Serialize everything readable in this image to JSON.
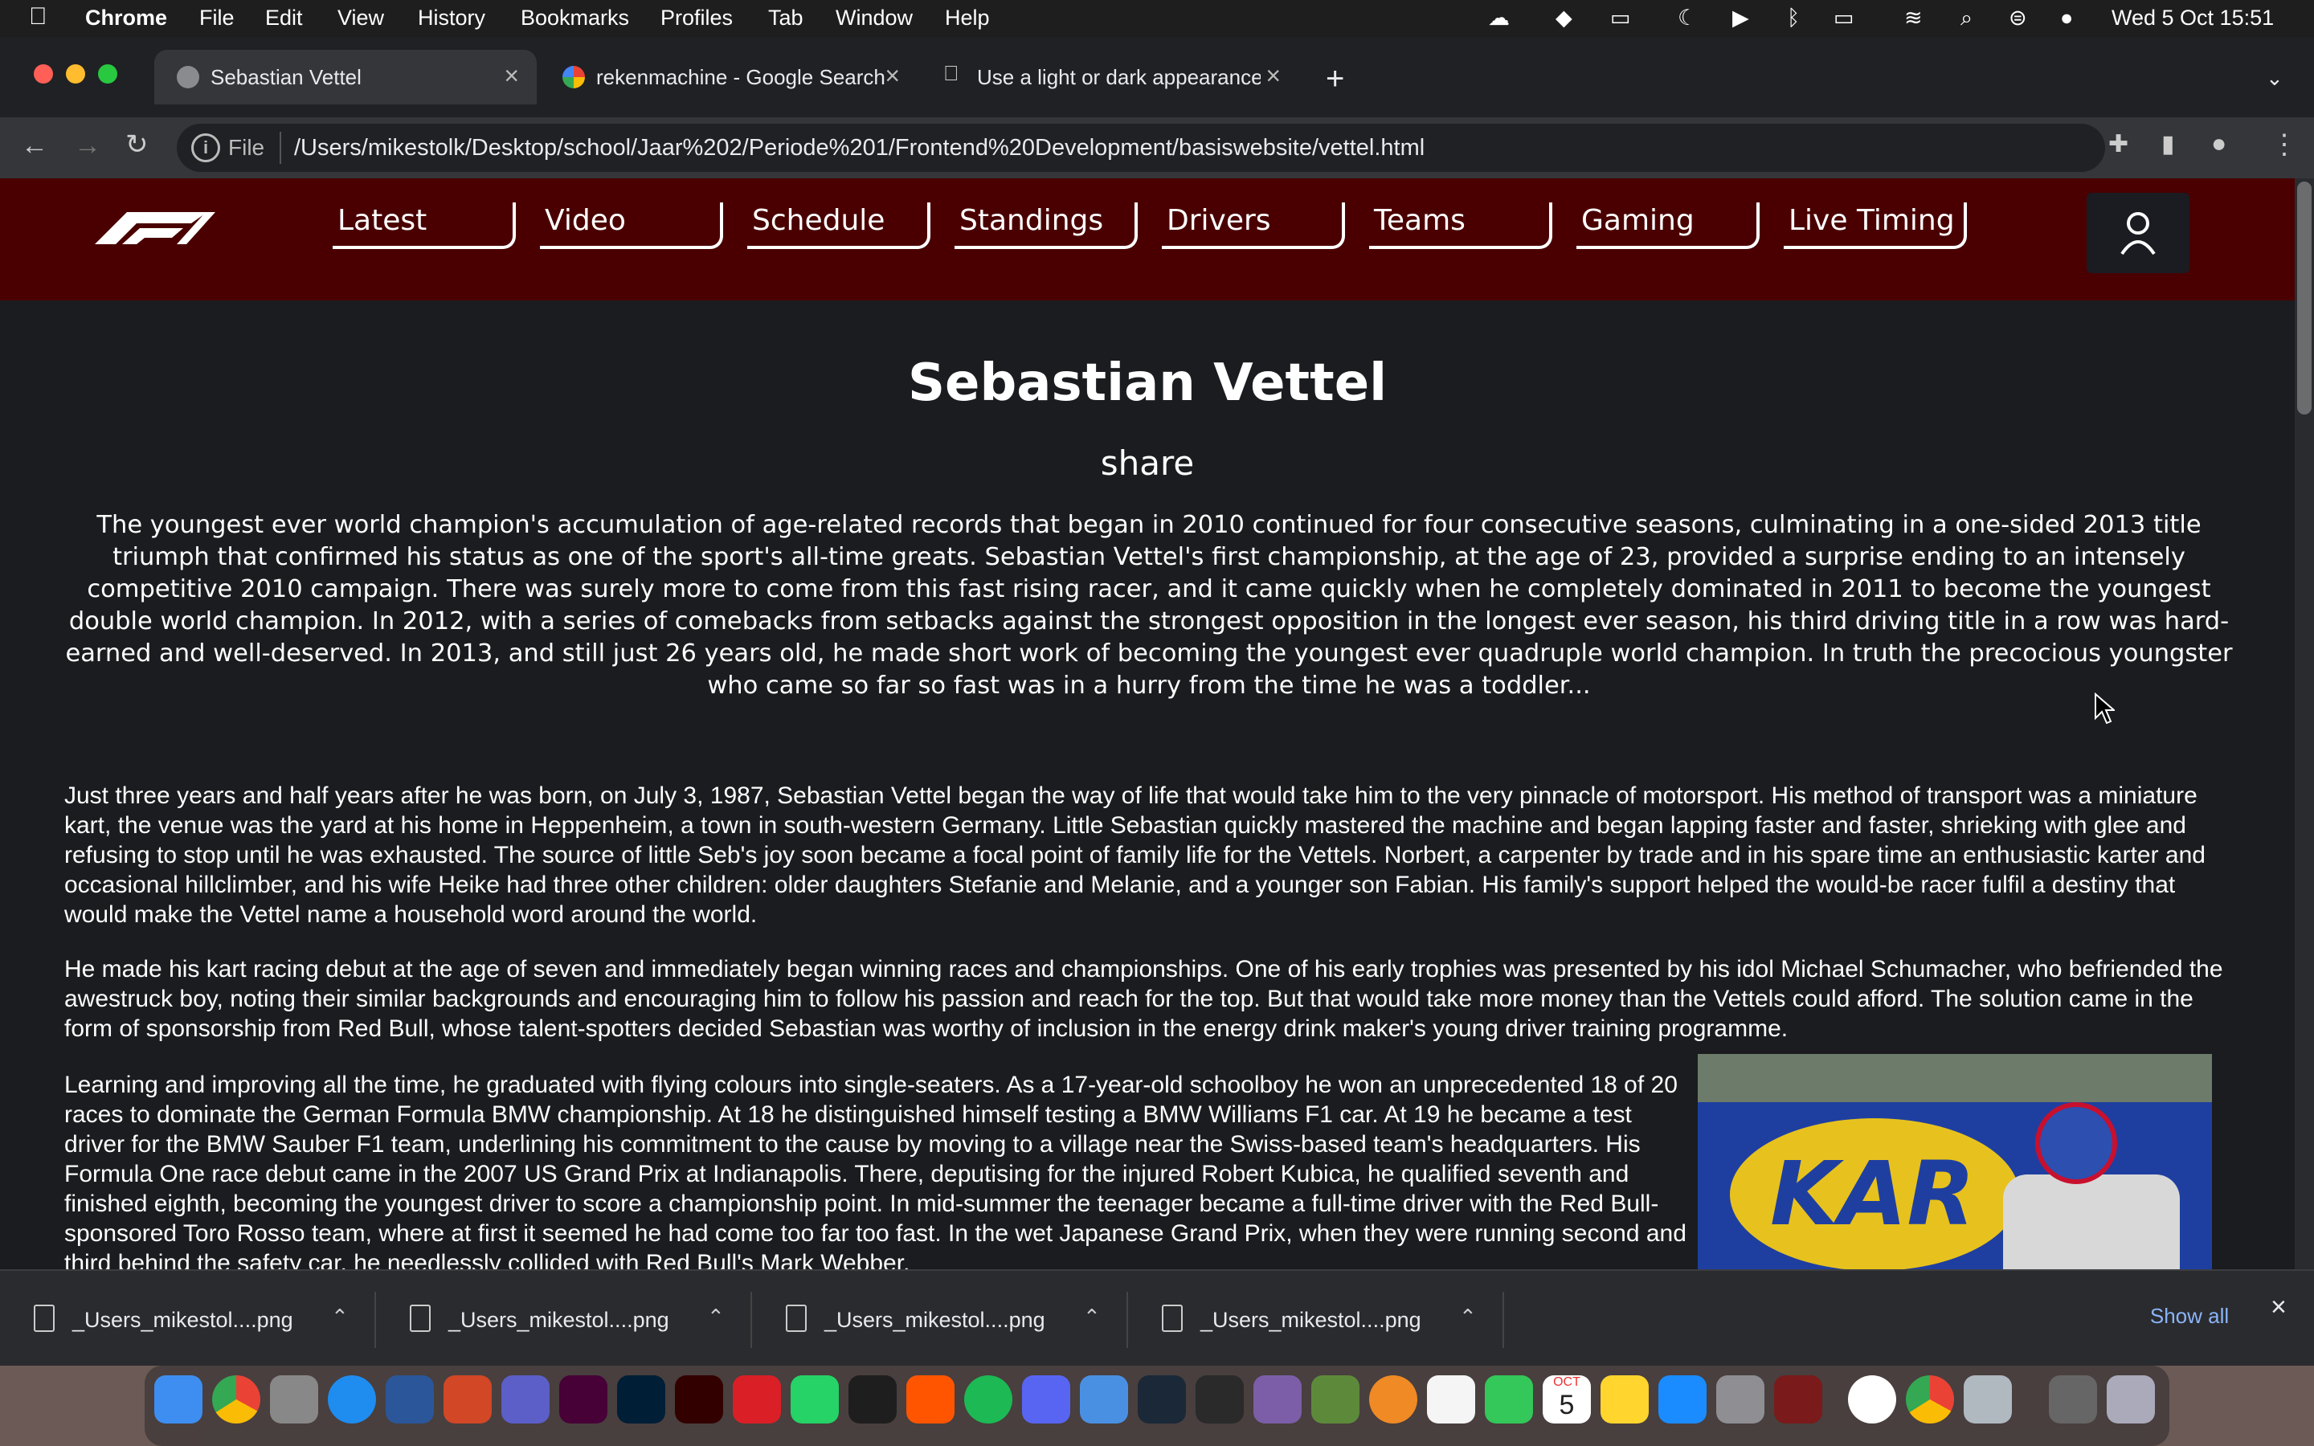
{
  "menubar": {
    "apple": "",
    "app": "Chrome",
    "items": [
      "File",
      "Edit",
      "View",
      "History",
      "Bookmarks",
      "Profiles",
      "Tab",
      "Window",
      "Help"
    ],
    "datetime": "Wed 5 Oct  15:51"
  },
  "tabs": [
    {
      "title": "Sebastian Vettel",
      "active": true
    },
    {
      "title": "rekenmachine - Google Search",
      "active": false
    },
    {
      "title": "Use a light or dark appearance",
      "active": false
    }
  ],
  "address": {
    "scheme_label": "File",
    "url": "/Users/mikestolk/Desktop/school/Jaar%202/Periode%201/Frontend%20Development/basiswebsite/vettel.html"
  },
  "nav": [
    "Latest",
    "Video",
    "Schedule",
    "Standings",
    "Drivers",
    "Teams",
    "Gaming",
    "Live Timing"
  ],
  "driver": {
    "name": "Sebastian Vettel",
    "share": "share",
    "intro": "The youngest ever world champion's accumulation of age-related records that began in 2010 continued for four consecutive seasons, culminating in a one-sided 2013 title triumph that confirmed his status as one of the sport's all-time greats. Sebastian Vettel's first championship, at the age of 23, provided a surprise ending to an intensely competitive 2010 campaign. There was surely more to come from this fast rising racer, and it came quickly when he completely dominated in 2011 to become the youngest double world champion. In 2012, with a series of comebacks from setbacks against the strongest opposition in the longest ever season, his third driving title in a row was hard-earned and well-deserved. In 2013, and still just 26 years old, he made short work of becoming the youngest ever quadruple world champion. In truth the precocious youngster who came so far so fast was in a hurry from the time he was a toddler...",
    "paragraphs": [
      "Just three years and half years after he was born, on July 3, 1987, Sebastian Vettel began the way of life that would take him to the very pinnacle of motorsport. His method of transport was a miniature kart, the venue was the yard at his home in Heppenheim, a town in south-western Germany. Little Sebastian quickly mastered the machine and began lapping faster and faster, shrieking with glee and refusing to stop until he was exhausted. The source of little Seb's joy soon became a focal point of family life for the Vettels. Norbert, a carpenter by trade and in his spare time an enthusiastic karter and occasional hillclimber, and his wife Heike had three other children: older daughters Stefanie and Melanie, and a younger son Fabian. His family's support helped the would-be racer fulfil a destiny that would make the Vettel name a household word around the world.",
      "He made his kart racing debut at the age of seven and immediately began winning races and championships. One of his early trophies was presented by his idol Michael Schumacher, who befriended the awestruck boy, noting their similar backgrounds and encouraging him to follow his passion and reach for the top. But that would take more money than the Vettels could afford. The solution came in the form of sponsorship from Red Bull, whose talent-spotters decided Sebastian was worthy of inclusion in the energy drink maker's young driver training programme.",
      "Learning and improving all the time, he graduated with flying colours into single-seaters. As a 17-year-old schoolboy he won an unprecedented 18 of 20 races to dominate the German Formula BMW championship. At 18 he distinguished himself testing a BMW Williams F1 car. At 19 he became a test driver for the BMW Sauber F1 team, underlining his commitment to the cause by moving to a village near the Swiss-based team's headquarters. His Formula One race debut came in the 2007 US Grand Prix at Indianapolis. There, deputising for the injured Robert Kubica, he qualified seventh and finished eighth, becoming the youngest driver to score a championship point. In mid-summer the teenager became a full-time driver with the Red Bull-sponsored Toro Rosso team, where at first it seemed he had come too far too fast. In the wet Japanese Grand Prix, when they were running second and third behind the safety car, he needlessly collided with Red Bull's Mark Webber."
    ],
    "image_text": "KAR"
  },
  "downloads": {
    "items": [
      "_Users_mikestol....png",
      "_Users_mikestol....png",
      "_Users_mikestol....png",
      "_Users_mikestol....png"
    ],
    "show_all": "Show all"
  },
  "dock": {
    "calendar_month": "OCT",
    "calendar_day": "5"
  },
  "colors": {
    "f1_header": "#4a0000",
    "page_bg": "#1b1c1f",
    "chrome_tab": "#35363a"
  }
}
